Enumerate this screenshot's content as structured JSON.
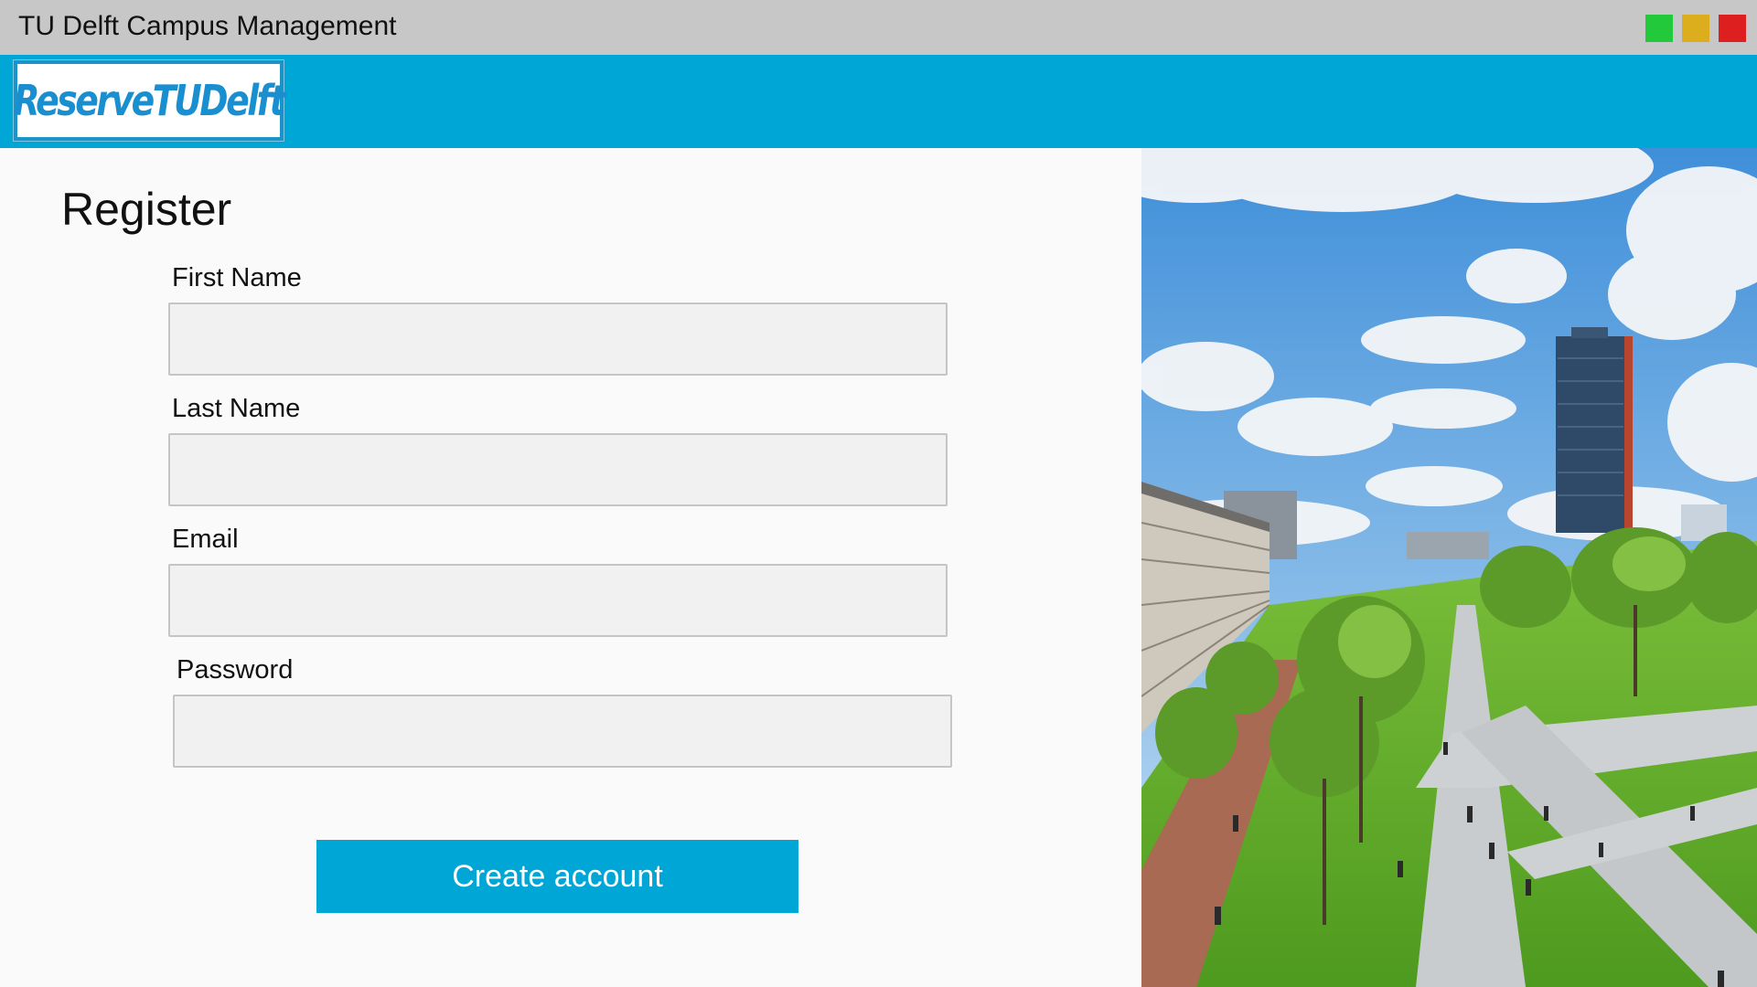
{
  "window": {
    "title": "TU Delft Campus Management",
    "controls": [
      "minimize",
      "maximize",
      "close"
    ],
    "colors": {
      "minimize": "#22c93a",
      "maximize": "#dcae1d",
      "close": "#dd1f1f"
    }
  },
  "header": {
    "logo_text": "ReserveTUDelft",
    "background": "#00a6d6"
  },
  "form": {
    "heading": "Register",
    "fields": [
      {
        "label": "First Name",
        "value": "",
        "placeholder": ""
      },
      {
        "label": "Last Name",
        "value": "",
        "placeholder": ""
      },
      {
        "label": "Email",
        "value": "",
        "placeholder": ""
      },
      {
        "label": "Password",
        "value": "",
        "placeholder": ""
      }
    ],
    "submit_label": "Create account"
  }
}
